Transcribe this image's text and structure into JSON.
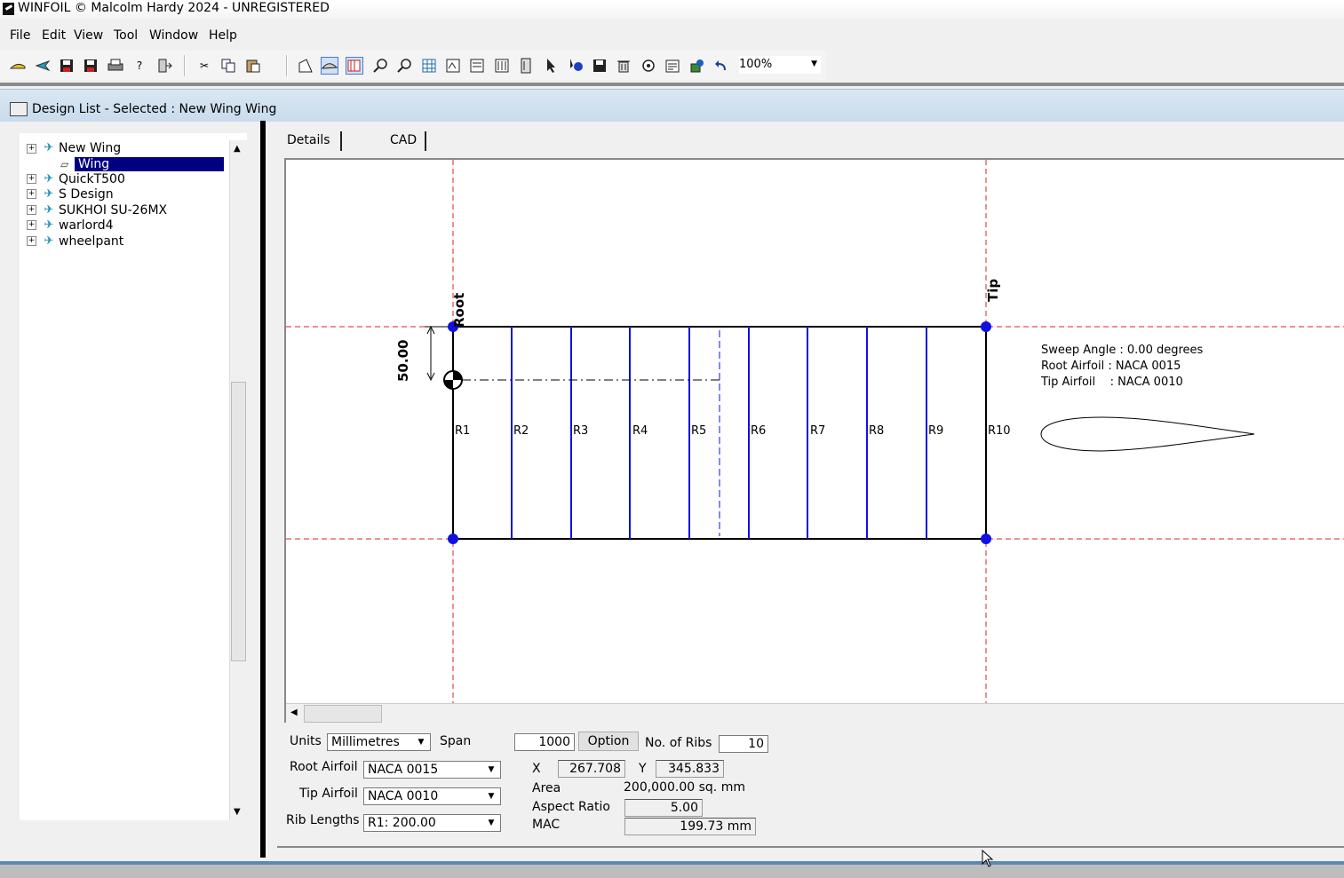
{
  "window": {
    "title": "WINFOIL © Malcolm Hardy 2024 - UNREGISTERED"
  },
  "menu": [
    "File",
    "Edit",
    "View",
    "Tool",
    "Window",
    "Help"
  ],
  "toolbar": {
    "zoom": "100%",
    "icons": [
      "open-wing-icon",
      "new-design-icon",
      "save-icon",
      "save-as-icon",
      "print-icon",
      "help-icon",
      "import-icon",
      "cut-icon",
      "copy-icon",
      "paste-icon",
      "plan-view-icon",
      "airfoil-view-icon",
      "rib-view-icon",
      "zoom-in-icon",
      "zoom-out-icon",
      "grid-icon",
      "tool-1-icon",
      "tool-2-icon",
      "tool-3-icon",
      "tool-4-icon",
      "pointer-icon",
      "select-icon",
      "save-disk-icon",
      "delete-icon",
      "options-icon",
      "properties-icon",
      "refresh-icon",
      "undo-icon"
    ]
  },
  "child_window": {
    "title": "Design List - Selected : New Wing Wing"
  },
  "tree": {
    "items": [
      {
        "label": "New Wing"
      },
      {
        "label": "Wing",
        "selected": true
      },
      {
        "label": "QuickT500"
      },
      {
        "label": "S Design"
      },
      {
        "label": "SUKHOI SU-26MX"
      },
      {
        "label": "warlord4"
      },
      {
        "label": "wheelpant"
      }
    ]
  },
  "tabs": [
    "Details",
    "CAD"
  ],
  "drawing": {
    "root_label": "Root",
    "tip_label": "Tip",
    "dimension": "50.00",
    "ribs": [
      "R1",
      "R2",
      "R3",
      "R4",
      "R5",
      "R6",
      "R7",
      "R8",
      "R9",
      "R10"
    ],
    "info": {
      "sweep": "Sweep Angle : 0.00 degrees",
      "root_airfoil": "Root Airfoil : NACA 0015",
      "tip_airfoil": "Tip Airfoil    : NACA 0010"
    }
  },
  "form": {
    "units_label": "Units",
    "units_value": "Millimetres",
    "span_label": "Span",
    "span_value": "1000",
    "option_button": "Option",
    "ribs_label": "No. of Ribs",
    "ribs_value": "10",
    "root_airfoil_label": "Root Airfoil",
    "root_airfoil_value": "NACA 0015",
    "tip_airfoil_label": "Tip Airfoil",
    "tip_airfoil_value": "NACA 0010",
    "rib_lengths_label": "Rib Lengths",
    "rib_lengths_value": "R1: 200.00",
    "x_label": "X",
    "x_value": "267.708",
    "y_label": "Y",
    "y_value": "345.833",
    "area_label": "Area",
    "area_value": "200,000.00 sq. mm",
    "aspect_label": "Aspect Ratio",
    "aspect_value": "5.00",
    "mac_label": "MAC",
    "mac_value": "199.73 mm"
  }
}
